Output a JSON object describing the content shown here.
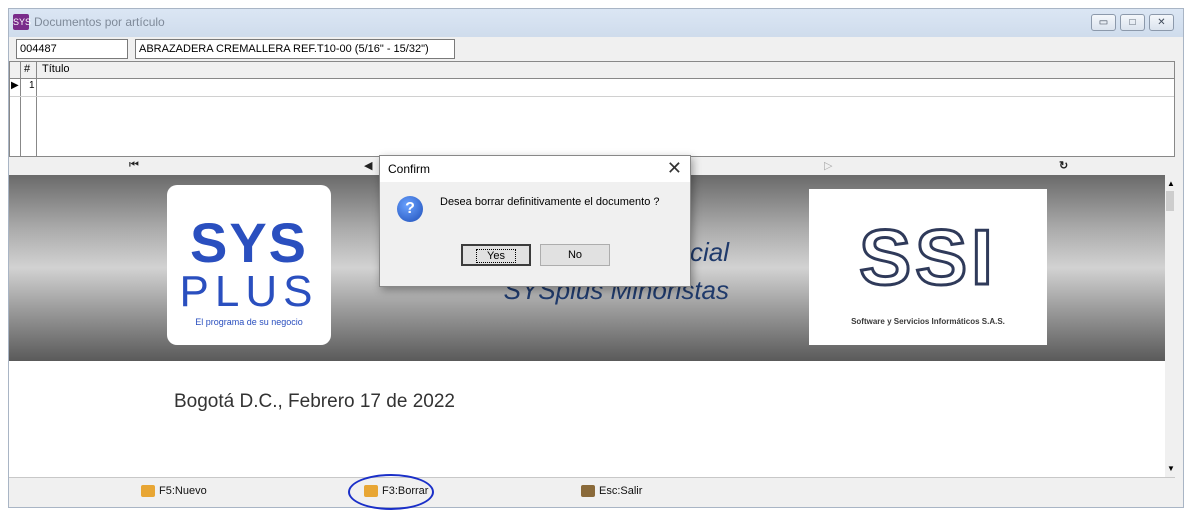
{
  "window": {
    "title": "Documentos por artículo",
    "app_icon": "SYS"
  },
  "controls": {
    "minimize": "▭",
    "maximize": "□",
    "close": "✕"
  },
  "article": {
    "code": "004487",
    "description": "ABRAZADERA CREMALLERA REF.T10-00  (5/16\" - 15/32\")"
  },
  "grid": {
    "headers": [
      "#",
      "Título"
    ],
    "rows": [
      {
        "num": "1",
        "title": ""
      }
    ],
    "indicator": "▶"
  },
  "nav": {
    "first": "⏮",
    "prev": "◀",
    "next_disabled": "▷",
    "refresh": "↻"
  },
  "document": {
    "logo_sys": {
      "line1": "SYS",
      "line2": "PLUS",
      "tagline": "El programa de su negocio"
    },
    "banner_line1": "cial",
    "banner_line2": "SYSplus Minoristas",
    "logo_ssi": {
      "line1": "SSI",
      "tagline": "Software y Servicios Informáticos S.A.S."
    },
    "date": "Bogotá D.C., Febrero 17 de 2022"
  },
  "statusbar": {
    "new": "F5:Nuevo",
    "delete": "F3:Borrar",
    "exit": "Esc:Salir"
  },
  "dialog": {
    "caption": "Confirm",
    "close": "✕",
    "icon": "?",
    "message": "Desea borrar definitivamente el documento ?",
    "yes": "Yes",
    "no": "No"
  }
}
